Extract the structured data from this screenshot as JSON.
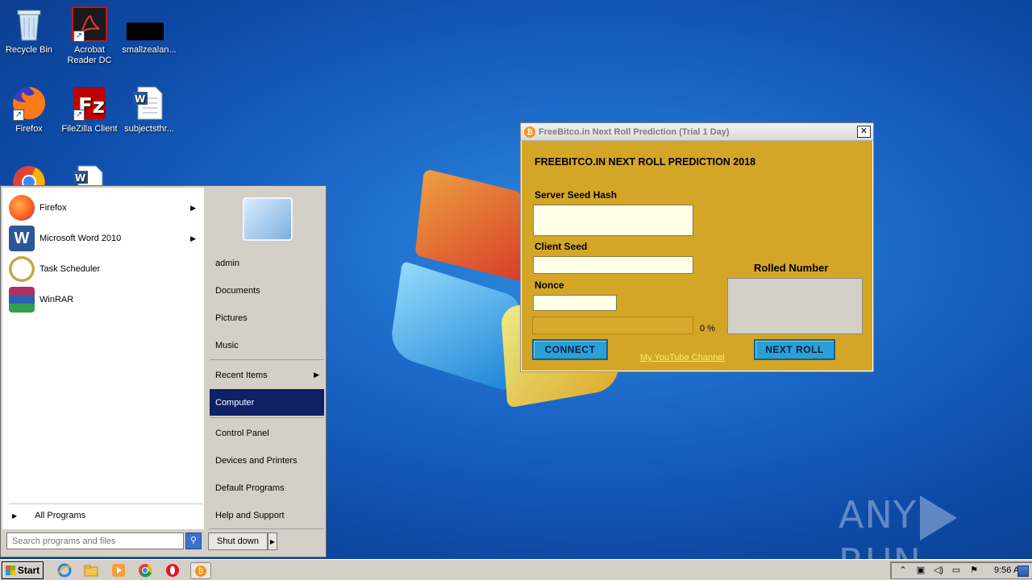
{
  "desktop_icons": [
    {
      "label": "Recycle Bin",
      "icon": "recycle-bin-icon"
    },
    {
      "label": "Acrobat Reader DC",
      "icon": "acrobat-icon"
    },
    {
      "label": "smallzealan...",
      "icon": "black-file-icon"
    },
    {
      "label": "Firefox",
      "icon": "firefox-icon"
    },
    {
      "label": "FileZilla Client",
      "icon": "filezilla-icon"
    },
    {
      "label": "subjectsthr...",
      "icon": "word-doc-icon"
    }
  ],
  "start_menu": {
    "programs": [
      {
        "label": "Firefox",
        "has_submenu": true
      },
      {
        "label": "Microsoft Word 2010",
        "has_submenu": true
      },
      {
        "label": "Task Scheduler",
        "has_submenu": false
      },
      {
        "label": "WinRAR",
        "has_submenu": false
      }
    ],
    "all_programs": "All Programs",
    "search_placeholder": "Search programs and files",
    "right_items": {
      "admin": "admin",
      "documents": "Documents",
      "pictures": "Pictures",
      "music": "Music",
      "recent_items": "Recent Items",
      "computer": "Computer",
      "control_panel": "Control Panel",
      "devices_printers": "Devices and Printers",
      "default_programs": "Default Programs",
      "help_support": "Help and Support"
    },
    "shutdown": "Shut down"
  },
  "app": {
    "title": "FreeBitco.in Next Roll Prediction (Trial 1 Day)",
    "heading": "FREEBITCO.IN NEXT ROLL PREDICTION 2018",
    "server_seed_label": "Server Seed Hash",
    "client_seed_label": "Client Seed",
    "nonce_label": "Nonce",
    "rolled_label": "Rolled Number",
    "progress_text": "0 %",
    "progress_value": 0,
    "connect_label": "CONNECT",
    "next_roll_label": "NEXT ROLL",
    "youtube_link": "My YouTube Channel"
  },
  "watermark": {
    "left": "ANY",
    "right": "RUN"
  },
  "taskbar": {
    "start_label": "Start",
    "clock": "9:56 AM"
  },
  "colors": {
    "app_bg": "#d4a628",
    "button_bg": "#2aa0d8",
    "selected_menu": "#0d2164"
  }
}
